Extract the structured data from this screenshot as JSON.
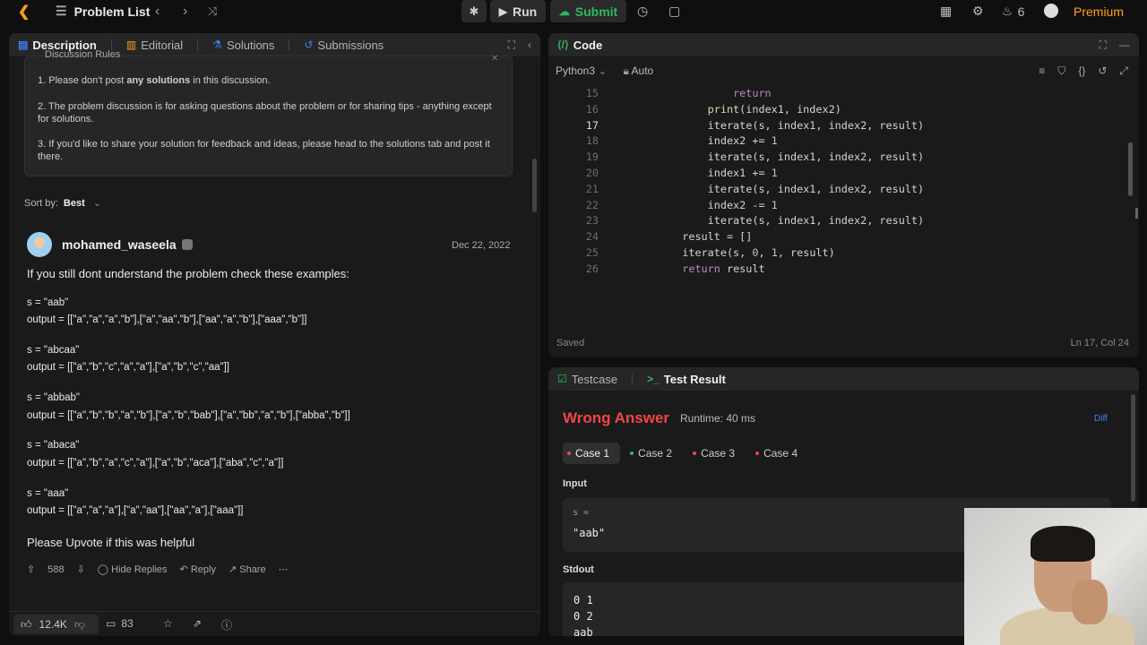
{
  "topbar": {
    "title": "Problem List",
    "run_label": "Run",
    "submit_label": "Submit",
    "streak": "6",
    "premium_label": "Premium"
  },
  "left_tabs": [
    {
      "label": "Description"
    },
    {
      "label": "Editorial"
    },
    {
      "label": "Solutions"
    },
    {
      "label": "Submissions"
    }
  ],
  "rules": {
    "title": "Discussion Rules",
    "items": [
      {
        "pre": "1. Please don't post ",
        "bold": "any solutions",
        "post": " in this discussion."
      },
      {
        "pre": "2. The problem discussion is for asking questions about the problem or for sharing tips - anything except for solutions.",
        "bold": "",
        "post": ""
      },
      {
        "pre": "3. If you'd like to share your solution for feedback and ideas, please head to the solutions tab and post it there.",
        "bold": "",
        "post": ""
      }
    ]
  },
  "sort": {
    "label": "Sort by:",
    "value": "Best"
  },
  "post": {
    "username": "mohamed_waseela",
    "date": "Dec 22, 2022",
    "intro": "If you still dont understand the problem check these examples:",
    "examples": [
      {
        "s": "s = \"aab\"",
        "output": "output = [[\"a\",\"a\",\"a\",\"b\"],[\"a\",\"aa\",\"b\"],[\"aa\",\"a\",\"b\"],[\"aaa\",\"b\"]]"
      },
      {
        "s": "s = \"abcaa\"",
        "output": "output = [[\"a\",\"b\",\"c\",\"a\",\"a\"],[\"a\",\"b\",\"c\",\"aa\"]]"
      },
      {
        "s": "s = \"abbab\"",
        "output": "output = [[\"a\",\"b\",\"b\",\"a\",\"b\"],[\"a\",\"b\",\"bab\"],[\"a\",\"bb\",\"a\",\"b\"],[\"abba\",\"b\"]]"
      },
      {
        "s": "s = \"abaca\"",
        "output": "output = [[\"a\",\"b\",\"a\",\"c\",\"a\"],[\"a\",\"b\",\"aca\"],[\"aba\",\"c\",\"a\"]]"
      },
      {
        "s": "s = \"aaa\"",
        "output": "output = [[\"a\",\"a\",\"a\"],[\"a\",\"aa\"],[\"aa\",\"a\"],[\"aaa\"]]"
      }
    ],
    "outro": "Please Upvote if this was helpful",
    "votes": "588",
    "hide_replies": "Hide Replies",
    "reply": "Reply",
    "share": "Share"
  },
  "bottom": {
    "likes": "12.4K",
    "comments": "83"
  },
  "code": {
    "title": "Code",
    "language": "Python3",
    "mode": "Auto",
    "saved": "Saved",
    "cursor": "Ln 17, Col 24",
    "lines": [
      {
        "n": "15",
        "indent": "            ",
        "parts": [
          {
            "t": "return",
            "c": "kw"
          }
        ]
      },
      {
        "n": "16",
        "indent": "        ",
        "parts": [
          {
            "t": "print",
            "c": "fn"
          },
          {
            "t": "(index1, index2)",
            "c": ""
          }
        ]
      },
      {
        "n": "17",
        "indent": "        ",
        "parts": [
          {
            "t": "iterate(s, index1, index2, result)",
            "c": ""
          }
        ]
      },
      {
        "n": "18",
        "indent": "        ",
        "parts": [
          {
            "t": "index2 += ",
            "c": ""
          },
          {
            "t": "1",
            "c": "num"
          }
        ]
      },
      {
        "n": "19",
        "indent": "        ",
        "parts": [
          {
            "t": "iterate(s, index1, index2, result)",
            "c": ""
          }
        ]
      },
      {
        "n": "20",
        "indent": "        ",
        "parts": [
          {
            "t": "index1 += ",
            "c": ""
          },
          {
            "t": "1",
            "c": "num"
          }
        ]
      },
      {
        "n": "21",
        "indent": "        ",
        "parts": [
          {
            "t": "iterate(s, index1, index2, result)",
            "c": ""
          }
        ]
      },
      {
        "n": "22",
        "indent": "        ",
        "parts": [
          {
            "t": "index2 -= ",
            "c": ""
          },
          {
            "t": "1",
            "c": "num"
          }
        ]
      },
      {
        "n": "23",
        "indent": "        ",
        "parts": [
          {
            "t": "iterate(s, index1, index2, result)",
            "c": ""
          }
        ]
      },
      {
        "n": "24",
        "indent": "    ",
        "parts": [
          {
            "t": "result = []",
            "c": ""
          }
        ]
      },
      {
        "n": "25",
        "indent": "    ",
        "parts": [
          {
            "t": "iterate(s, ",
            "c": ""
          },
          {
            "t": "0",
            "c": "num"
          },
          {
            "t": ", ",
            "c": ""
          },
          {
            "t": "1",
            "c": "num"
          },
          {
            "t": ", result)",
            "c": ""
          }
        ]
      },
      {
        "n": "26",
        "indent": "    ",
        "parts": [
          {
            "t": "return",
            "c": "kw"
          },
          {
            "t": " result",
            "c": ""
          }
        ]
      }
    ],
    "current_line": "17"
  },
  "result": {
    "tab_testcase": "Testcase",
    "tab_result": "Test Result",
    "status": "Wrong Answer",
    "runtime": "Runtime: 40 ms",
    "diff": "Diff",
    "cases": [
      {
        "label": "Case 1",
        "status": "fail"
      },
      {
        "label": "Case 2",
        "status": "pass"
      },
      {
        "label": "Case 3",
        "status": "fail"
      },
      {
        "label": "Case 4",
        "status": "fail"
      }
    ],
    "input_label": "Input",
    "input_key": "s =",
    "input_value": "\"aab\"",
    "stdout_label": "Stdout",
    "stdout_lines": [
      "0 1",
      "0 2",
      "aab"
    ]
  },
  "colors": {
    "accent": "#ffa116",
    "success": "#2cbb5d",
    "error": "#ef4743",
    "link": "#3b82f6"
  }
}
